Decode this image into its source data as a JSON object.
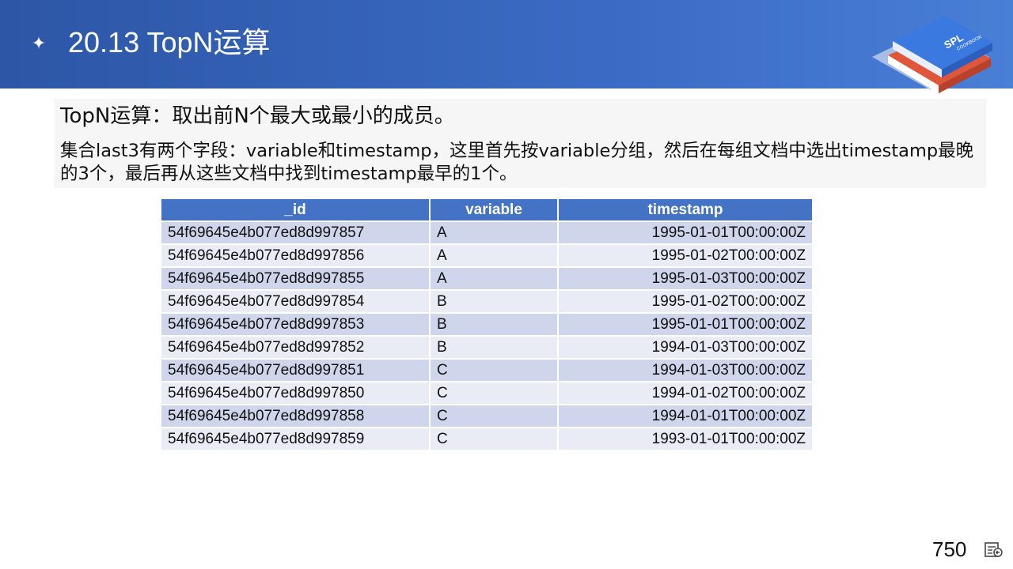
{
  "slide": {
    "title": "20.13 TopN运算",
    "star_glyph": "✦"
  },
  "logo": {
    "text_main": "SPL",
    "text_sub": "COOKBOOK"
  },
  "description": {
    "line1": "TopN运算：取出前N个最大或最小的成员。",
    "line2": "集合last3有两个字段：variable和timestamp，这里首先按variable分组，然后在每组文档中选出timestamp最晚的3个，最后再从这些文档中找到timestamp最早的1个。"
  },
  "table": {
    "columns": [
      "_id",
      "variable",
      "timestamp"
    ],
    "rows": [
      [
        "54f69645e4b077ed8d997857",
        "A",
        "1995-01-01T00:00:00Z"
      ],
      [
        "54f69645e4b077ed8d997856",
        "A",
        "1995-01-02T00:00:00Z"
      ],
      [
        "54f69645e4b077ed8d997855",
        "A",
        "1995-01-03T00:00:00Z"
      ],
      [
        "54f69645e4b077ed8d997854",
        "B",
        "1995-01-02T00:00:00Z"
      ],
      [
        "54f69645e4b077ed8d997853",
        "B",
        "1995-01-01T00:00:00Z"
      ],
      [
        "54f69645e4b077ed8d997852",
        "B",
        "1994-01-03T00:00:00Z"
      ],
      [
        "54f69645e4b077ed8d997851",
        "C",
        "1994-01-03T00:00:00Z"
      ],
      [
        "54f69645e4b077ed8d997850",
        "C",
        "1994-01-02T00:00:00Z"
      ],
      [
        "54f69645e4b077ed8d997858",
        "C",
        "1994-01-01T00:00:00Z"
      ],
      [
        "54f69645e4b077ed8d997859",
        "C",
        "1993-01-01T00:00:00Z"
      ]
    ]
  },
  "footer": {
    "page_number": "750",
    "notes_icon": "notes-icon"
  },
  "colors": {
    "header_blue": "#2d56a6",
    "table_header": "#4472c4",
    "row_odd": "#cfd5ea",
    "row_even": "#e9ebf5"
  }
}
